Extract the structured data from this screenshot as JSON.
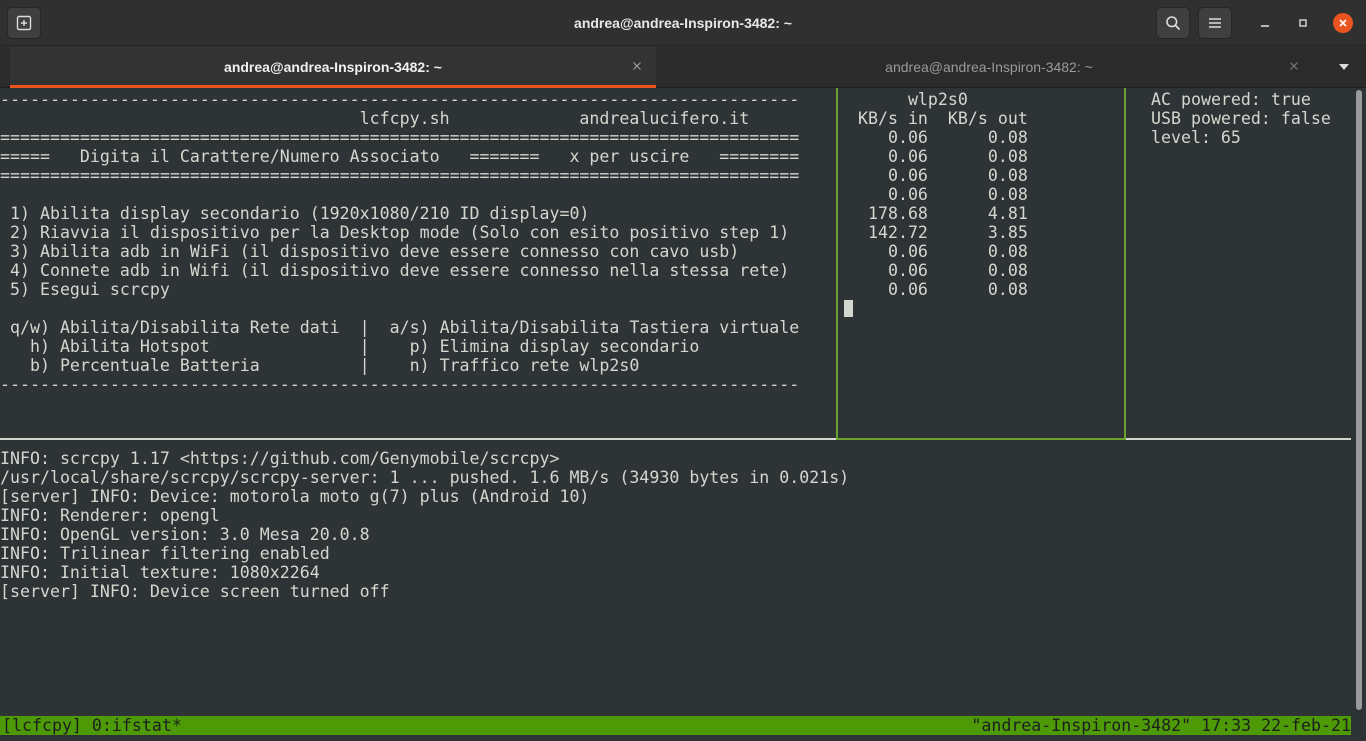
{
  "window": {
    "title": "andrea@andrea-Inspiron-3482: ~"
  },
  "icons": {
    "new_tab": "new-tab-icon",
    "search": "search-icon",
    "menu": "hamburger-icon",
    "minimize": "minimize-icon",
    "maximize": "maximize-icon",
    "close": "close-icon",
    "tab_menu": "chevron-down-icon"
  },
  "colors": {
    "accent": "#e95420",
    "terminal_bg": "#2e3436",
    "terminal_fg": "#d3d7cf",
    "tmux_status": "#4e9a06",
    "active_pane_border": "#6ba22f"
  },
  "tabs": [
    {
      "label": "andrea@andrea-Inspiron-3482: ~",
      "active": true
    },
    {
      "label": "andrea@andrea-Inspiron-3482: ~",
      "active": false
    }
  ],
  "menu_pane": {
    "lines": [
      "--------------------------------------------------------------------------------",
      "                                    lcfcpy.sh             andrealucifero.it",
      "================================================================================",
      "=====   Digita il Carattere/Numero Associato   =======   x per uscire   ========",
      "================================================================================",
      "",
      " 1) Abilita display secondario (1920x1080/210 ID display=0)",
      " 2) Riavvia il dispositivo per la Desktop mode (Solo con esito positivo step 1)",
      " 3) Abilita adb in WiFi (il dispositivo deve essere connesso con cavo usb)",
      " 4) Connete adb in Wifi (il dispositivo deve essere connesso nella stessa rete)",
      " 5) Esegui scrcpy",
      "",
      " q/w) Abilita/Disabilita Rete dati  |  a/s) Abilita/Disabilita Tastiera virtuale",
      "   h) Abilita Hotspot               |    p) Elimina display secondario",
      "   b) Percentuale Batteria          |    n) Traffico rete wlp2s0",
      "--------------------------------------------------------------------------------"
    ]
  },
  "ifstat_pane": {
    "lines": [
      "      wlp2s0",
      " KB/s in  KB/s out",
      "    0.06      0.08",
      "    0.06      0.08",
      "    0.06      0.08",
      "    0.06      0.08",
      "  178.68      4.81",
      "  142.72      3.85",
      "    0.06      0.08",
      "    0.06      0.08",
      "    0.06      0.08"
    ]
  },
  "power_pane": {
    "lines": [
      "AC powered: true",
      "USB powered: false",
      "level: 65"
    ]
  },
  "log_pane": {
    "lines": [
      "INFO: scrcpy 1.17 <https://github.com/Genymobile/scrcpy>",
      "/usr/local/share/scrcpy/scrcpy-server: 1 ... pushed. 1.6 MB/s (34930 bytes in 0.021s)",
      "[server] INFO: Device: motorola moto g(7) plus (Android 10)",
      "INFO: Renderer: opengl",
      "INFO: OpenGL version: 3.0 Mesa 20.0.8",
      "INFO: Trilinear filtering enabled",
      "INFO: Initial texture: 1080x2264",
      "[server] INFO: Device screen turned off"
    ]
  },
  "status_bar": {
    "left": "[lcfcpy] 0:ifstat*",
    "right": "\"andrea-Inspiron-3482\" 17:33 22-feb-21"
  }
}
